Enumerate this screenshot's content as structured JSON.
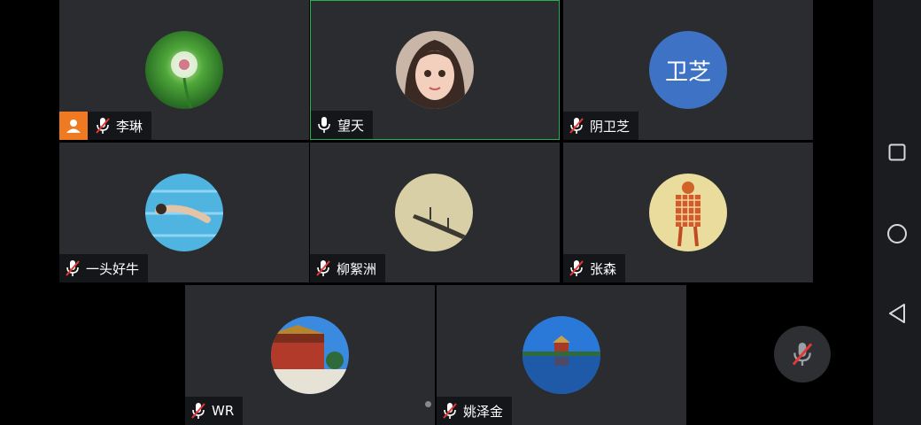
{
  "participants": [
    {
      "name": "李琳",
      "muted": true,
      "is_host": true,
      "avatar": "dandelion-photo"
    },
    {
      "name": "望天",
      "muted": false,
      "active_speaker": true,
      "avatar": "girl-portrait"
    },
    {
      "name": "阴卫芝",
      "muted": true,
      "avatar_initials": "卫芝",
      "avatar_color": "#3d72c4"
    },
    {
      "name": "一头好牛",
      "muted": true,
      "avatar": "swimmer-photo"
    },
    {
      "name": "柳絮洲",
      "muted": true,
      "avatar": "boat-photo"
    },
    {
      "name": "张森",
      "muted": true,
      "avatar": "plaid-figure-photo"
    },
    {
      "name": "WR",
      "muted": true,
      "avatar": "palace-photo"
    },
    {
      "name": "姚泽金",
      "muted": true,
      "avatar": "turret-lake-photo"
    }
  ],
  "colors": {
    "active_border": "#25b34a",
    "host_badge": "#f07a22",
    "tile_bg": "#2a2c30",
    "muted_slash": "#e53935"
  },
  "nav_icons": [
    "recent-apps-icon",
    "home-icon",
    "back-icon"
  ],
  "floating_button": "mute-mic-button"
}
